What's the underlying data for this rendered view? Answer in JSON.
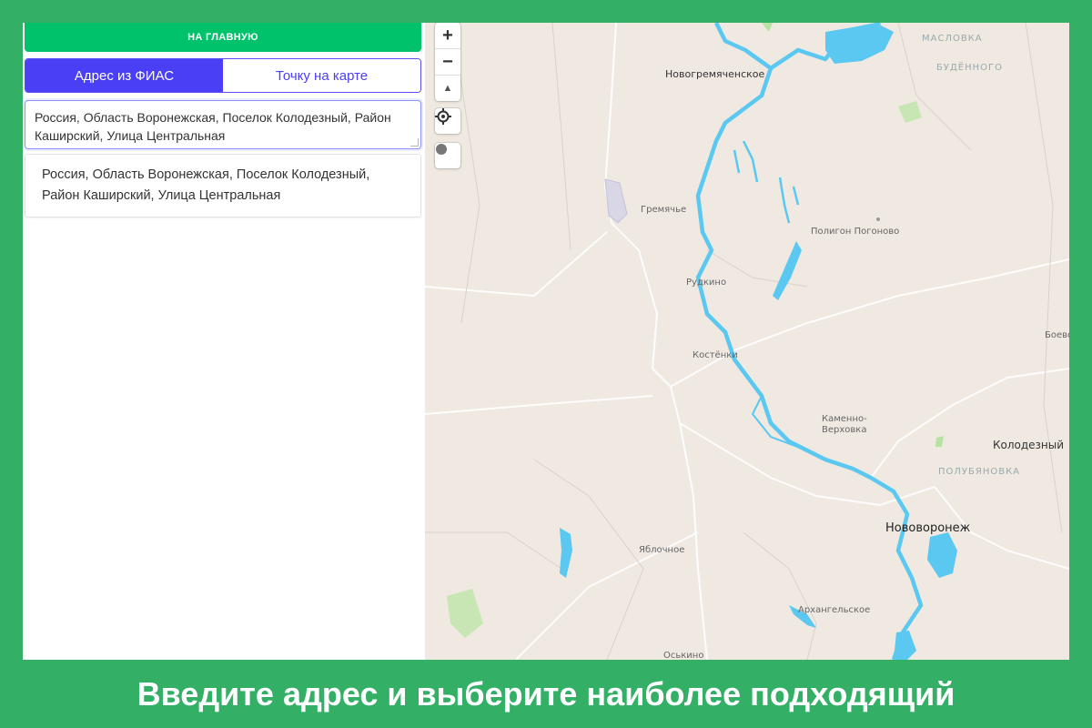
{
  "panel": {
    "home_label": "НА ГЛАВНУЮ",
    "tabs": [
      {
        "label": "Адрес из ФИАС",
        "active": true
      },
      {
        "label": "Точку на карте",
        "active": false
      }
    ],
    "address_value": "Россия, Область Воронежская, Поселок Колодезный, Район Каширский, Улица Центральная",
    "suggestions": [
      "Россия, Область Воронежская, Поселок Колодезный, Район Каширский, Улица Центральная"
    ]
  },
  "map": {
    "controls": {
      "zoom_in": "+",
      "zoom_out": "−",
      "compass": "▲",
      "locate_icon": "crosshair-icon",
      "dot_icon": "circle-icon"
    },
    "labels": {
      "maslovka": "МАСЛОВКА",
      "budennogo": "БУДЁННОГО",
      "novogremyachenskoe": "Новогремяченское",
      "gremyachye": "Гремячье",
      "poligon": "Полигон Погоново",
      "rudkino": "Рудкино",
      "kostenki": "Костёнки",
      "kamenno": "Каменно-",
      "verhovka": "Верховка",
      "boevo": "Боево",
      "kolodezny": "Колодезный",
      "polubyanovka": "ПОЛУБЯНОВКА",
      "novovoronezh": "Нововоронеж",
      "yablochnoe": "Яблочное",
      "arhangelskoe": "Архангельское",
      "oskino": "Оськино"
    },
    "colors": {
      "land": "#efe9e1",
      "water": "#5ac8f0",
      "park": "#c8e6b4"
    }
  },
  "caption": "Введите адрес и выберите наиболее подходящий"
}
